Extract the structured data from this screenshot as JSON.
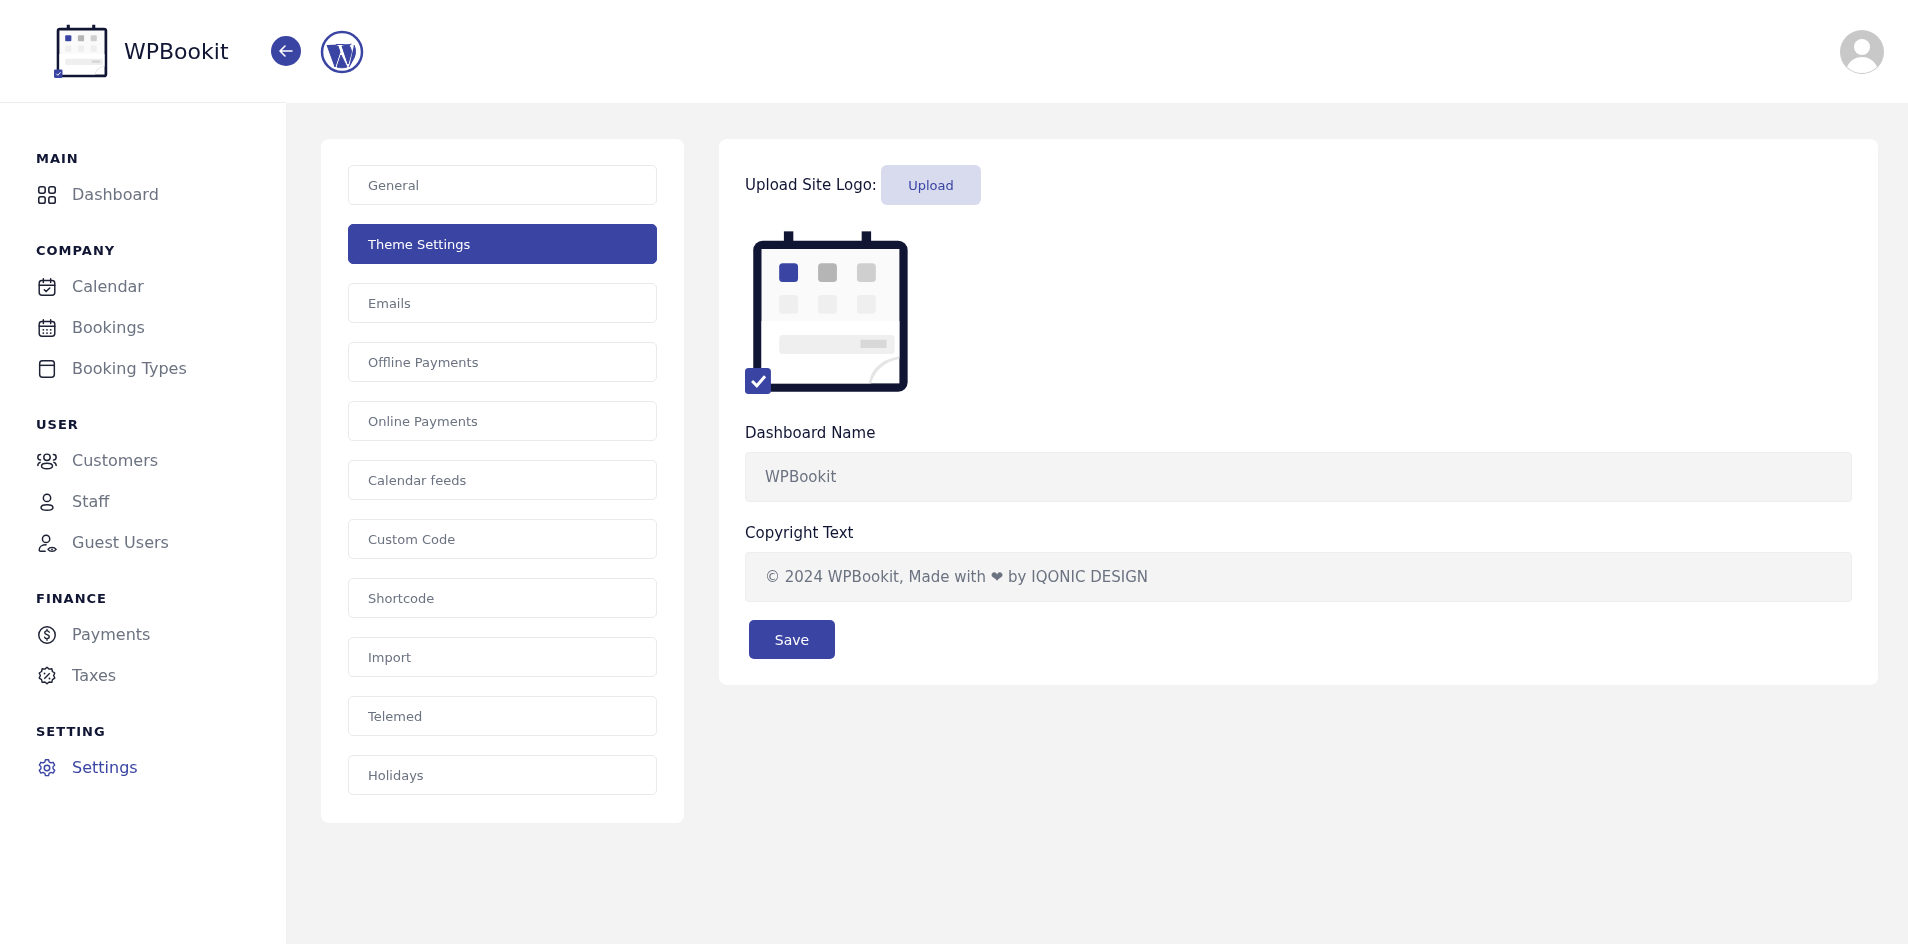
{
  "brand": {
    "name": "WPBookit"
  },
  "sidebar": {
    "sections": [
      {
        "title": "MAIN",
        "items": [
          {
            "label": "Dashboard",
            "kind": "grid",
            "selected": false
          }
        ]
      },
      {
        "title": "COMPANY",
        "items": [
          {
            "label": "Calendar",
            "kind": "calendar",
            "selected": false
          },
          {
            "label": "Bookings",
            "kind": "bookings",
            "selected": false
          },
          {
            "label": "Booking Types",
            "kind": "types",
            "selected": false
          }
        ]
      },
      {
        "title": "USER",
        "items": [
          {
            "label": "Customers",
            "kind": "customers",
            "selected": false
          },
          {
            "label": "Staff",
            "kind": "staff",
            "selected": false
          },
          {
            "label": "Guest Users",
            "kind": "guests",
            "selected": false
          }
        ]
      },
      {
        "title": "FINANCE",
        "items": [
          {
            "label": "Payments",
            "kind": "payments",
            "selected": false
          },
          {
            "label": "Taxes",
            "kind": "taxes",
            "selected": false
          }
        ]
      },
      {
        "title": "SETTING",
        "items": [
          {
            "label": "Settings",
            "kind": "settings",
            "selected": true
          }
        ]
      }
    ]
  },
  "settings_menu": [
    {
      "label": "General",
      "selected": false
    },
    {
      "label": "Theme Settings",
      "selected": true
    },
    {
      "label": "Emails",
      "selected": false
    },
    {
      "label": "Offline Payments",
      "selected": false
    },
    {
      "label": "Online Payments",
      "selected": false
    },
    {
      "label": "Calendar feeds",
      "selected": false
    },
    {
      "label": "Custom Code",
      "selected": false
    },
    {
      "label": "Shortcode",
      "selected": false
    },
    {
      "label": "Import",
      "selected": false
    },
    {
      "label": "Telemed",
      "selected": false
    },
    {
      "label": "Holidays",
      "selected": false
    }
  ],
  "theme_settings": {
    "upload_label": "Upload Site Logo:",
    "upload_button": "Upload",
    "fields": [
      {
        "label": "Dashboard Name",
        "value": "WPBookit"
      },
      {
        "label": "Copyright Text",
        "value": "© 2024 WPBookit, Made with ❤ by IQONIC DESIGN"
      }
    ],
    "save_button": "Save"
  }
}
